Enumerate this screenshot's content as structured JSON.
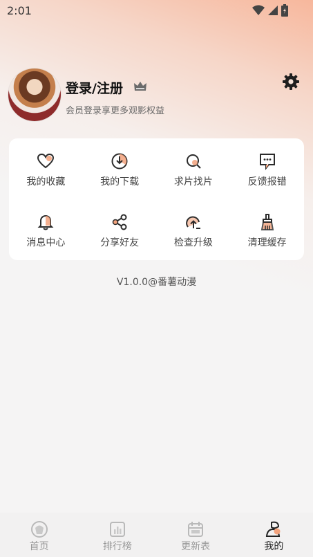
{
  "status_bar": {
    "time": "2:01"
  },
  "profile": {
    "title": "登录/注册",
    "subtitle": "会员登录享更多观影权益"
  },
  "menu": {
    "items": [
      {
        "label": "我的收藏",
        "icon": "heart-icon"
      },
      {
        "label": "我的下载",
        "icon": "download-icon"
      },
      {
        "label": "求片找片",
        "icon": "search-film-icon"
      },
      {
        "label": "反馈报错",
        "icon": "feedback-icon"
      },
      {
        "label": "消息中心",
        "icon": "bell-icon"
      },
      {
        "label": "分享好友",
        "icon": "share-icon"
      },
      {
        "label": "检查升级",
        "icon": "upgrade-icon"
      },
      {
        "label": "清理缓存",
        "icon": "clean-icon"
      }
    ]
  },
  "version": "V1.0.0@番薯动漫",
  "bottom_nav": {
    "items": [
      {
        "label": "首页",
        "icon": "home-icon",
        "active": false
      },
      {
        "label": "排行榜",
        "icon": "ranking-icon",
        "active": false
      },
      {
        "label": "更新表",
        "icon": "calendar-icon",
        "active": false
      },
      {
        "label": "我的",
        "icon": "profile-icon",
        "active": true
      }
    ]
  },
  "colors": {
    "accent": "#f2a27c",
    "text": "#222222",
    "muted": "#999999"
  }
}
